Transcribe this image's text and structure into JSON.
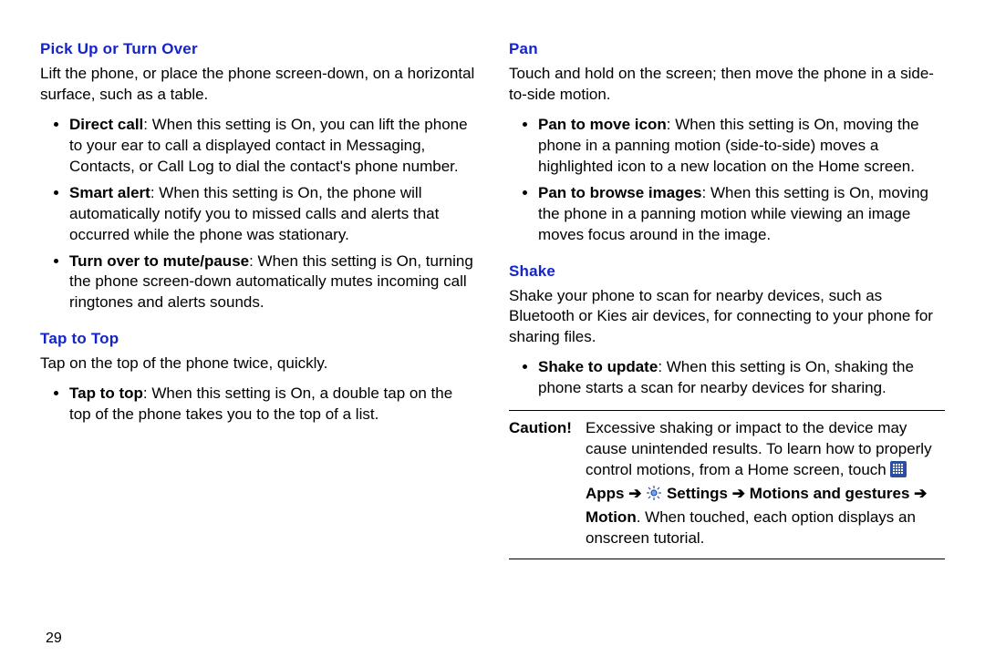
{
  "page_number": "29",
  "left": {
    "heading1": "Pick Up or Turn Over",
    "intro1": "Lift the phone, or place the phone screen-down, on a horizontal surface, such as a table.",
    "bullets1": [
      {
        "title": "Direct call",
        "text": ": When this setting is On, you can lift the phone to your ear to call a displayed contact in Messaging, Contacts, or Call Log to dial the contact's phone number."
      },
      {
        "title": "Smart alert",
        "text": ": When this setting is On, the phone will automatically notify you to missed calls and alerts that occurred while the phone was stationary."
      },
      {
        "title": "Turn over to mute/pause",
        "text": ": When this setting is On, turning the phone screen-down automatically mutes incoming call ringtones and alerts sounds."
      }
    ],
    "heading2": "Tap to Top",
    "intro2": "Tap on the top of the phone twice, quickly.",
    "bullets2": [
      {
        "title": "Tap to top",
        "text": ": When this setting is On, a double tap on the top of the phone takes you to the top of a list."
      }
    ]
  },
  "right": {
    "heading1": "Pan",
    "intro1": "Touch and hold on the screen; then move the phone in a side-to-side motion.",
    "bullets1": [
      {
        "title": "Pan to move icon",
        "text": ": When this setting is On, moving the phone in a panning motion (side-to-side) moves a highlighted icon to a new location on the Home screen."
      },
      {
        "title": "Pan to browse images",
        "text": ": When this setting is On, moving the phone in a panning motion while viewing an image moves focus around in the image."
      }
    ],
    "heading2": "Shake",
    "intro2": "Shake your phone to scan for nearby devices, such as Bluetooth or Kies air devices, for connecting to your phone for sharing files.",
    "bullets2": [
      {
        "title": "Shake to update",
        "text": ": When this setting is On, shaking the phone starts a scan for nearby devices for sharing."
      }
    ],
    "caution": {
      "label": "Caution!",
      "pre": "Excessive shaking or impact to the device may cause unintended results. To learn how to properly control motions, from a Home screen, touch ",
      "path_apps": "Apps",
      "arrow": "➔",
      "path_settings": "Settings",
      "path_motionsg": "Motions and gestures",
      "path_motion": "Motion",
      "post": ". When touched, each option displays an onscreen tutorial."
    }
  }
}
